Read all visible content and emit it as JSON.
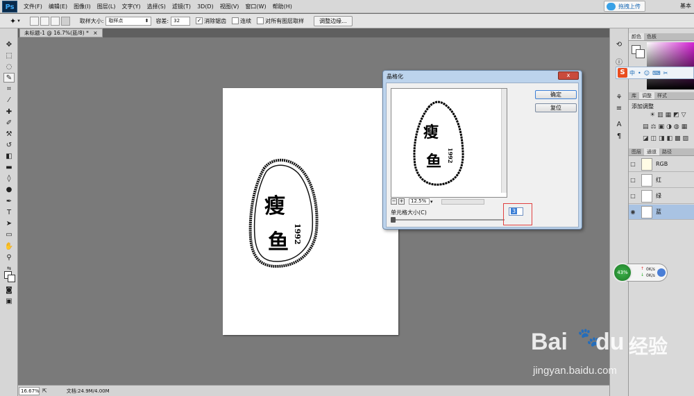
{
  "app": {
    "logo": "Ps",
    "menu": [
      "文件(F)",
      "编辑(E)",
      "图像(I)",
      "图层(L)",
      "文字(Y)",
      "选择(S)",
      "滤镜(T)",
      "3D(D)",
      "视图(V)",
      "窗口(W)",
      "帮助(H)"
    ],
    "upload_label": "拖拽上传",
    "workspace": "基本"
  },
  "options": {
    "sample_size_label": "取样大小:",
    "sample_size_value": "取样点",
    "tolerance_label": "容差:",
    "tolerance_value": "32",
    "antialias_label": "消除锯齿",
    "contiguous_label": "连续",
    "all_layers_label": "对所有图层取样",
    "refine_edge_label": "调整边缘..."
  },
  "document": {
    "tab_title": "未标题-1 @ 16.7%(蓝/8) *",
    "stamp_text": "瘦鱼",
    "stamp_year": "1992"
  },
  "status": {
    "zoom": "16.67%",
    "doc_info": "文档:24.9M/4.00M"
  },
  "dialog": {
    "title": "晶格化",
    "close_label": "x",
    "ok_label": "确定",
    "reset_label": "复位",
    "preview_zoom": "12.5%",
    "cell_size_label": "单元格大小(C)",
    "cell_size_value": "3",
    "slider_fraction": 0.0
  },
  "panels": {
    "color_tabs": [
      "颜色",
      "色板"
    ],
    "adjust_tabs": [
      "库",
      "调整",
      "样式"
    ],
    "adjust_title": "添加调整",
    "layer_tabs": [
      "图层",
      "通道",
      "路径"
    ],
    "channels": [
      {
        "name": "RGB",
        "selected": false,
        "visible": false
      },
      {
        "name": "红",
        "selected": false,
        "visible": false
      },
      {
        "name": "绿",
        "selected": false,
        "visible": false
      },
      {
        "name": "蓝",
        "selected": true,
        "visible": true
      }
    ]
  },
  "widgets": {
    "net_percent": "43%",
    "net_up": "0K/s",
    "net_down": "0K/s"
  },
  "watermark": {
    "brand": "Bai",
    "brand2": "du",
    "cn": "经验",
    "url": "jingyan.baidu.com"
  },
  "colors": {
    "dialog_frame": "#bcd3ec",
    "highlight": "#e04040",
    "channel_selected": "#a9c3e3"
  }
}
